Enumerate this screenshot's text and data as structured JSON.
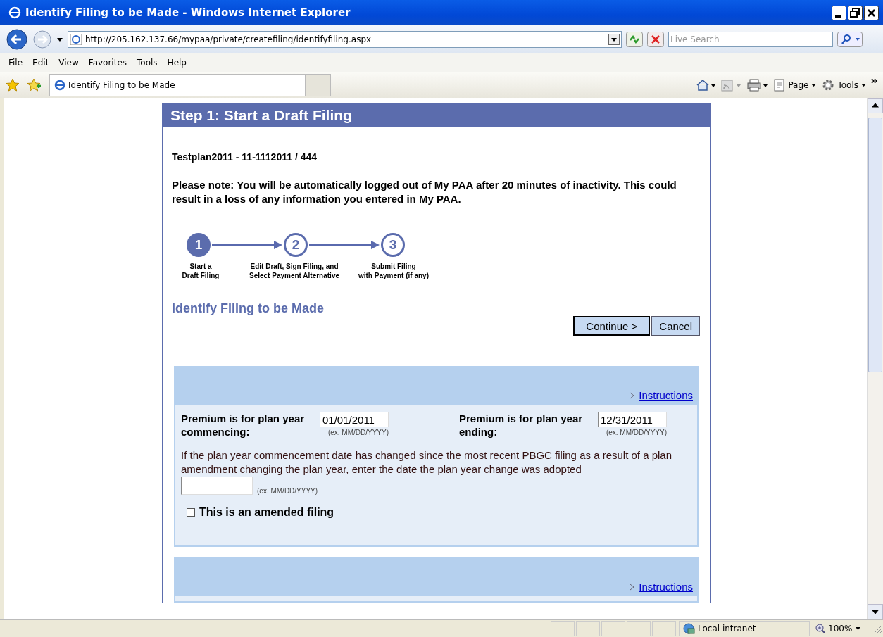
{
  "window": {
    "title": "Identify Filing to be Made - Windows Internet Explorer"
  },
  "address_bar": {
    "url": "http://205.162.137.66/mypaa/private/createfiling/identifyfiling.aspx"
  },
  "search": {
    "placeholder": "Live Search"
  },
  "menu": [
    "File",
    "Edit",
    "View",
    "Favorites",
    "Tools",
    "Help"
  ],
  "tabs": [
    {
      "label": "Identify Filing to be Made",
      "selected": true
    }
  ],
  "command_bar": [
    "Page",
    "Tools"
  ],
  "page": {
    "header": "Step 1: Start a Draft Filing",
    "plan_id": "Testplan2011 - 11-1112011 / 444",
    "note": "Please note: You will be automatically logged out of My PAA after 20 minutes of inactivity. This could result in a loss of any information you entered in My PAA.",
    "steps": [
      {
        "number": "1",
        "label": "Start a\nDraft Filing",
        "selected": true
      },
      {
        "number": "2",
        "label": "Edit Draft, Sign Filing, and\nSelect Payment Alternative",
        "selected": false
      },
      {
        "number": "3",
        "label": "Submit Filing\nwith Payment (if any)",
        "selected": false
      }
    ],
    "section_title": "Identify Filing to be Made",
    "buttons": [
      "Continue >",
      "Cancel"
    ],
    "panels": [
      {
        "link": "Instructions",
        "dates": [
          {
            "label": "Premium is for plan year commencing:",
            "value": "01/01/2011",
            "hint": "(ex. MM/DD/YYYY)"
          },
          {
            "label": "Premium is for plan year ending:",
            "value": "12/31/2011",
            "hint": "(ex. MM/DD/YYYY)"
          }
        ],
        "change_text": "If the plan year commencement date has changed since the most recent PBGC filing as a result of a plan amendment changing the plan year, enter the date the plan year change was adopted",
        "change_hint": "(ex. MM/DD/YYYY)",
        "amended": {
          "label": "This is an amended filing",
          "checked": false
        }
      },
      {
        "link": "Instructions"
      }
    ]
  },
  "status_bar": {
    "zone": "Local intranet",
    "zoom": "100%"
  }
}
